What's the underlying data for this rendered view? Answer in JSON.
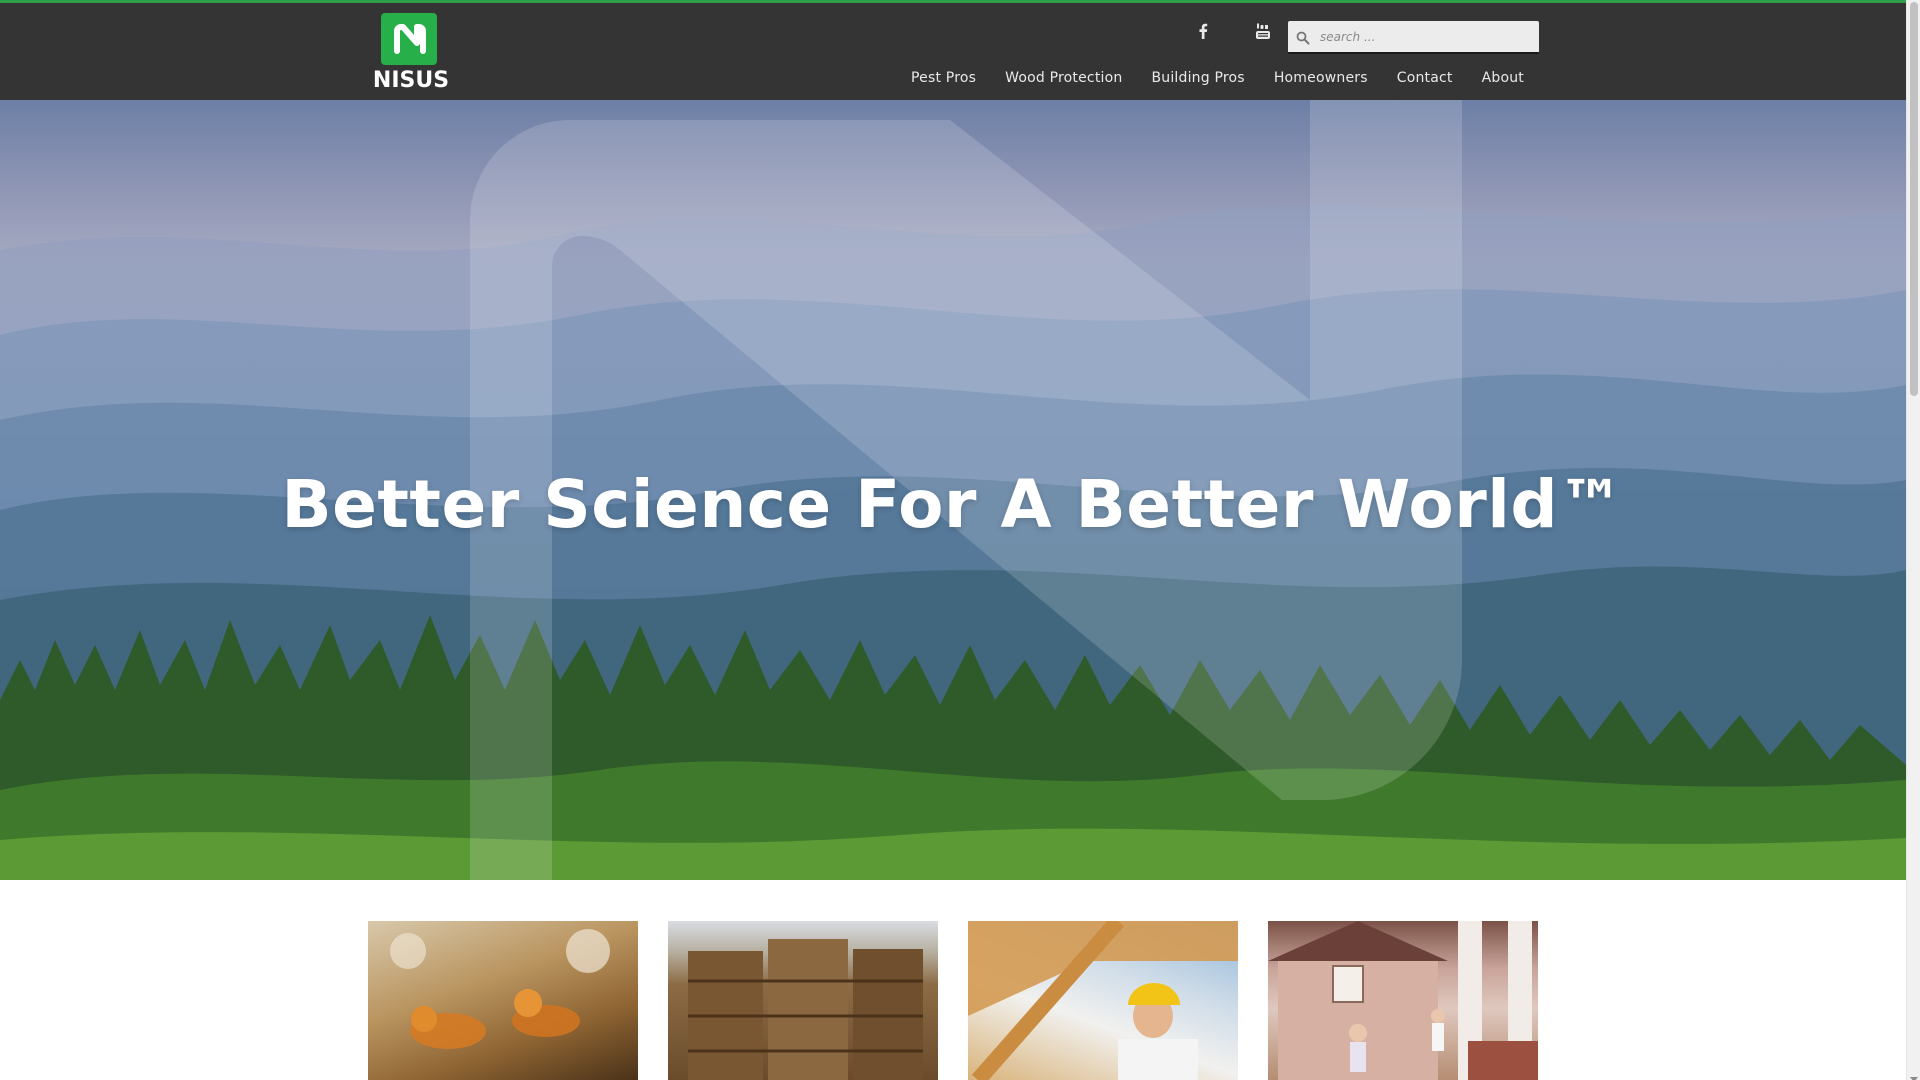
{
  "header": {
    "logo": {
      "wordmark": "NISUS",
      "brand_color": "#27b04a"
    },
    "social": [
      {
        "name": "facebook",
        "icon": "facebook-icon"
      },
      {
        "name": "youtube",
        "icon": "youtube-icon"
      }
    ],
    "search": {
      "placeholder": "search ...",
      "value": "",
      "icon": "search-icon"
    },
    "nav": [
      {
        "label": "Pest Pros"
      },
      {
        "label": "Wood Protection"
      },
      {
        "label": "Building Pros"
      },
      {
        "label": "Homeowners"
      },
      {
        "label": "Contact"
      },
      {
        "label": "About"
      }
    ],
    "top_border_color": "#2f9e48",
    "background_color": "#343434"
  },
  "hero": {
    "title": "Better Science For A Better World™",
    "image": "blue ridge mountains and evergreen forest with large translucent N logo overlay"
  },
  "cards": [
    {
      "image": "termites-close-up"
    },
    {
      "image": "stacked-lumber"
    },
    {
      "image": "builder-with-hard-hat"
    },
    {
      "image": "family-at-house"
    }
  ]
}
